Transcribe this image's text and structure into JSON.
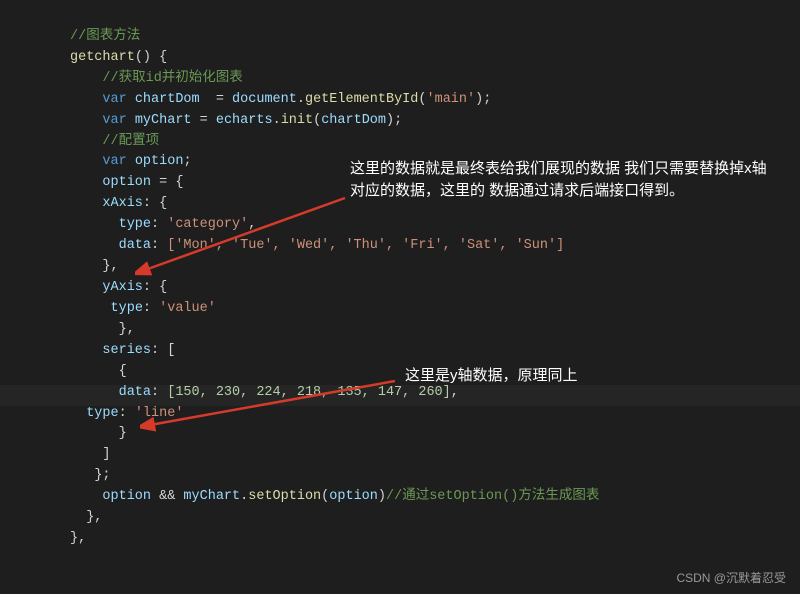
{
  "code": {
    "l1_comment": "//图表方法",
    "l2_func": "getchart",
    "l3_comment": "//获取id并初始化图表",
    "l4_var": "var",
    "l4_name": "chartDom",
    "l4_eq": "  = ",
    "l4_doc": "document",
    "l4_dot": ".",
    "l4_method": "getElementById",
    "l4_arg": "'main'",
    "l5_name": "myChart",
    "l5_obj": "echarts",
    "l5_method": "init",
    "l5_arg": "chartDom",
    "l6_comment": "//配置项",
    "l7_name": "option",
    "l9_prop": "xAxis",
    "l10_prop": "type",
    "l10_val": "'category'",
    "l11_prop": "data",
    "l11_vals": "['Mon', 'Tue', 'Wed', 'Thu', 'Fri', 'Sat', 'Sun']",
    "l13_prop": "yAxis",
    "l14_val": "'value'",
    "l16_prop": "series",
    "l18_prop": "data",
    "l18_vals": "[150, 230, 224, 218, 135, 147, 260]",
    "l19_prop": "type",
    "l19_val": "'line'",
    "l23_expr_a": "option",
    "l23_and": " && ",
    "l23_obj": "myChart",
    "l23_method": "setOption",
    "l23_arg": "option",
    "l23_comment": "//通过setOption()方法生成图表"
  },
  "annotations": {
    "a1": "这里的数据就是最终表给我们展现的数据\n我们只需要替换掉x轴对应的数据，这里的\n数据通过请求后端接口得到。",
    "a2": "这里是y轴数据，原理同上"
  },
  "watermark": "CSDN @沉默着忍受",
  "chart_data": {
    "type": "line",
    "categories": [
      "Mon",
      "Tue",
      "Wed",
      "Thu",
      "Fri",
      "Sat",
      "Sun"
    ],
    "values": [
      150,
      230,
      224,
      218,
      135,
      147,
      260
    ],
    "title": "",
    "xlabel": "",
    "ylabel": "",
    "ylim": [
      0,
      300
    ]
  }
}
